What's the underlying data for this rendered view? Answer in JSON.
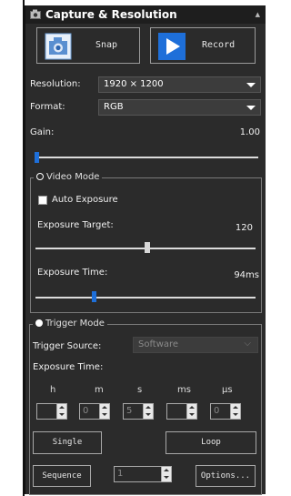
{
  "window": {
    "title": "Capture & Resolution"
  },
  "actions": {
    "snap_label": "Snap",
    "record_label": "Record"
  },
  "resolution": {
    "label": "Resolution:",
    "value": "1920 × 1200"
  },
  "format": {
    "label": "Format:",
    "value": "RGB"
  },
  "gain": {
    "label": "Gain:",
    "value": "1.00",
    "level": 0.0
  },
  "video_mode": {
    "title": "Video Mode",
    "auto_exposure_label": "Auto Exposure",
    "exposure_target_label": "Exposure Target:",
    "exposure_target_value": "120",
    "exposure_time_label": "Exposure Time:",
    "exposure_time_value": "94ms"
  },
  "trigger_mode": {
    "title": "Trigger Mode",
    "source_label": "Trigger Source:",
    "source_value": "Software",
    "exposure_time_label": "Exposure Time:",
    "units": {
      "h": "h",
      "m": "m",
      "s": "s",
      "ms": "ms",
      "us": "µs"
    },
    "values": {
      "h": "",
      "m": "0",
      "s": "5",
      "ms": "",
      "us": "0"
    },
    "single_label": "Single",
    "loop_label": "Loop",
    "sequence_label": "Sequence",
    "sequence_count": "1",
    "options_label": "Options..."
  },
  "colors": {
    "panel": "#2b2b2b",
    "accent_blue": "#1e6fd9",
    "text": "#ffffff"
  }
}
